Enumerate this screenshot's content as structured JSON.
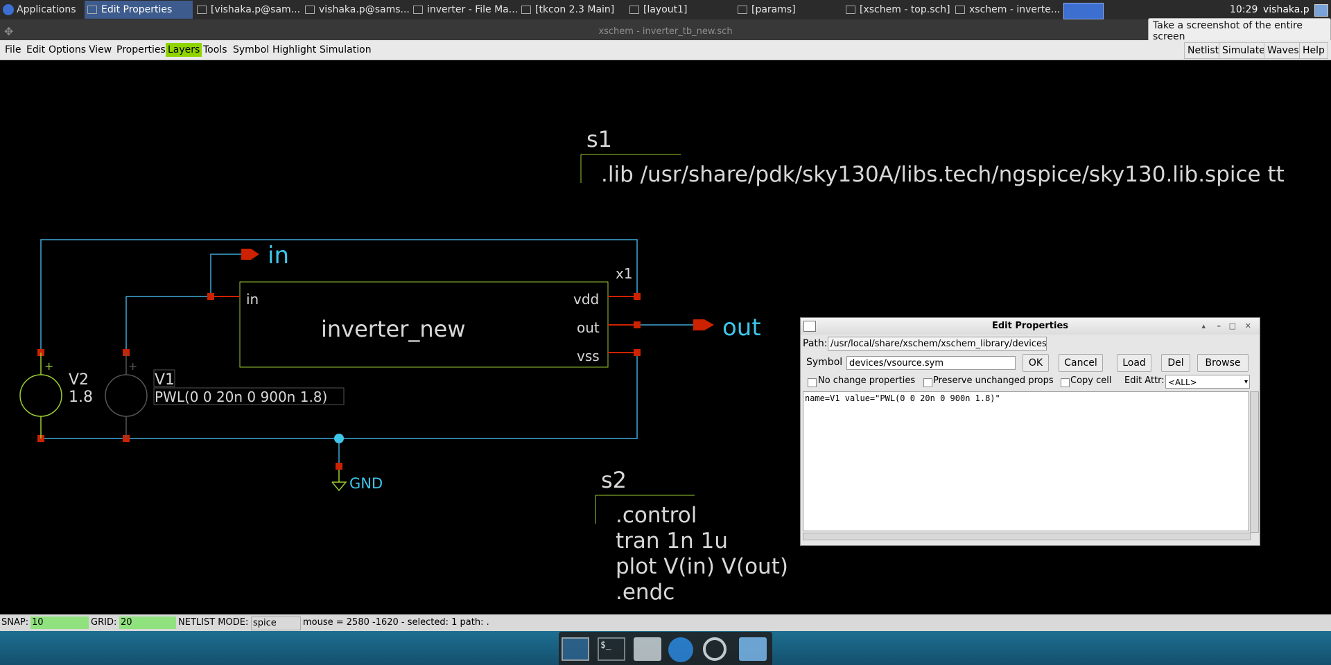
{
  "panel": {
    "apps_label": "Applications",
    "tasks": [
      "Edit Properties",
      "[vishaka.p@sam...",
      "vishaka.p@sams...",
      "inverter - File Ma...",
      "[tkcon 2.3 Main]",
      "[layout1]",
      "[params]",
      "[xschem - top.sch]",
      "xschem - inverte..."
    ],
    "clock": "10:29",
    "user": "vishaka.p",
    "tooltip": "Take a screenshot of the entire screen"
  },
  "window": {
    "title": "xschem - inverter_tb_new.sch"
  },
  "menubar": {
    "items": [
      "File",
      "Edit",
      "Options",
      "View",
      "Properties",
      "Layers",
      "Tools",
      "Symbol",
      "Highlight",
      "Simulation"
    ],
    "right_buttons": [
      "Netlist",
      "Simulate",
      "Waves",
      "Help"
    ]
  },
  "schematic": {
    "s1_name": "s1",
    "s1_text": ".lib /usr/share/pdk/sky130A/libs.tech/ngspice/sky130.lib.spice tt",
    "in_label": "in",
    "out_label": "out",
    "x1_name": "x1",
    "block_name": "inverter_new",
    "pin_in": "in",
    "pin_vdd": "vdd",
    "pin_out": "out",
    "pin_vss": "vss",
    "v2_name": "V2",
    "v2_value": "1.8",
    "v1_name": "V1",
    "v1_value": "PWL(0 0 20n 0 900n 1.8)",
    "gnd_label": "GND",
    "s2_name": "s2",
    "s2_lines": [
      ".control",
      "tran 1n 1u",
      "plot V(in) V(out)",
      ".endc"
    ]
  },
  "dialog": {
    "title": "Edit Properties",
    "path_label": "Path:",
    "path_value": "/usr/local/share/xschem/xschem_library/devices",
    "symbol_label": "Symbol",
    "symbol_value": "devices/vsource.sym",
    "ok": "OK",
    "cancel": "Cancel",
    "load": "Load",
    "del": "Del",
    "browse": "Browse",
    "no_change": "No change properties",
    "preserve": "Preserve unchanged props",
    "copy_cell": "Copy cell",
    "edit_attr_label": "Edit Attr:",
    "edit_attr_value": "<ALL>",
    "text": "name=V1 value=\"PWL(0 0 20n 0 900n 1.8)\""
  },
  "status": {
    "snap_label": "SNAP:",
    "snap_value": "10",
    "grid_label": "GRID:",
    "grid_value": "20",
    "netlist_label": "NETLIST MODE:",
    "netlist_value": "spice",
    "mouse_info": "mouse = 2580 -1620 - selected: 1 path: ."
  },
  "colors": {
    "wire": "#3fa9d8",
    "symbol": "#9acd32",
    "pin": "#cc2200",
    "label": "#3fc5ea",
    "text": "#d8d8d8"
  }
}
